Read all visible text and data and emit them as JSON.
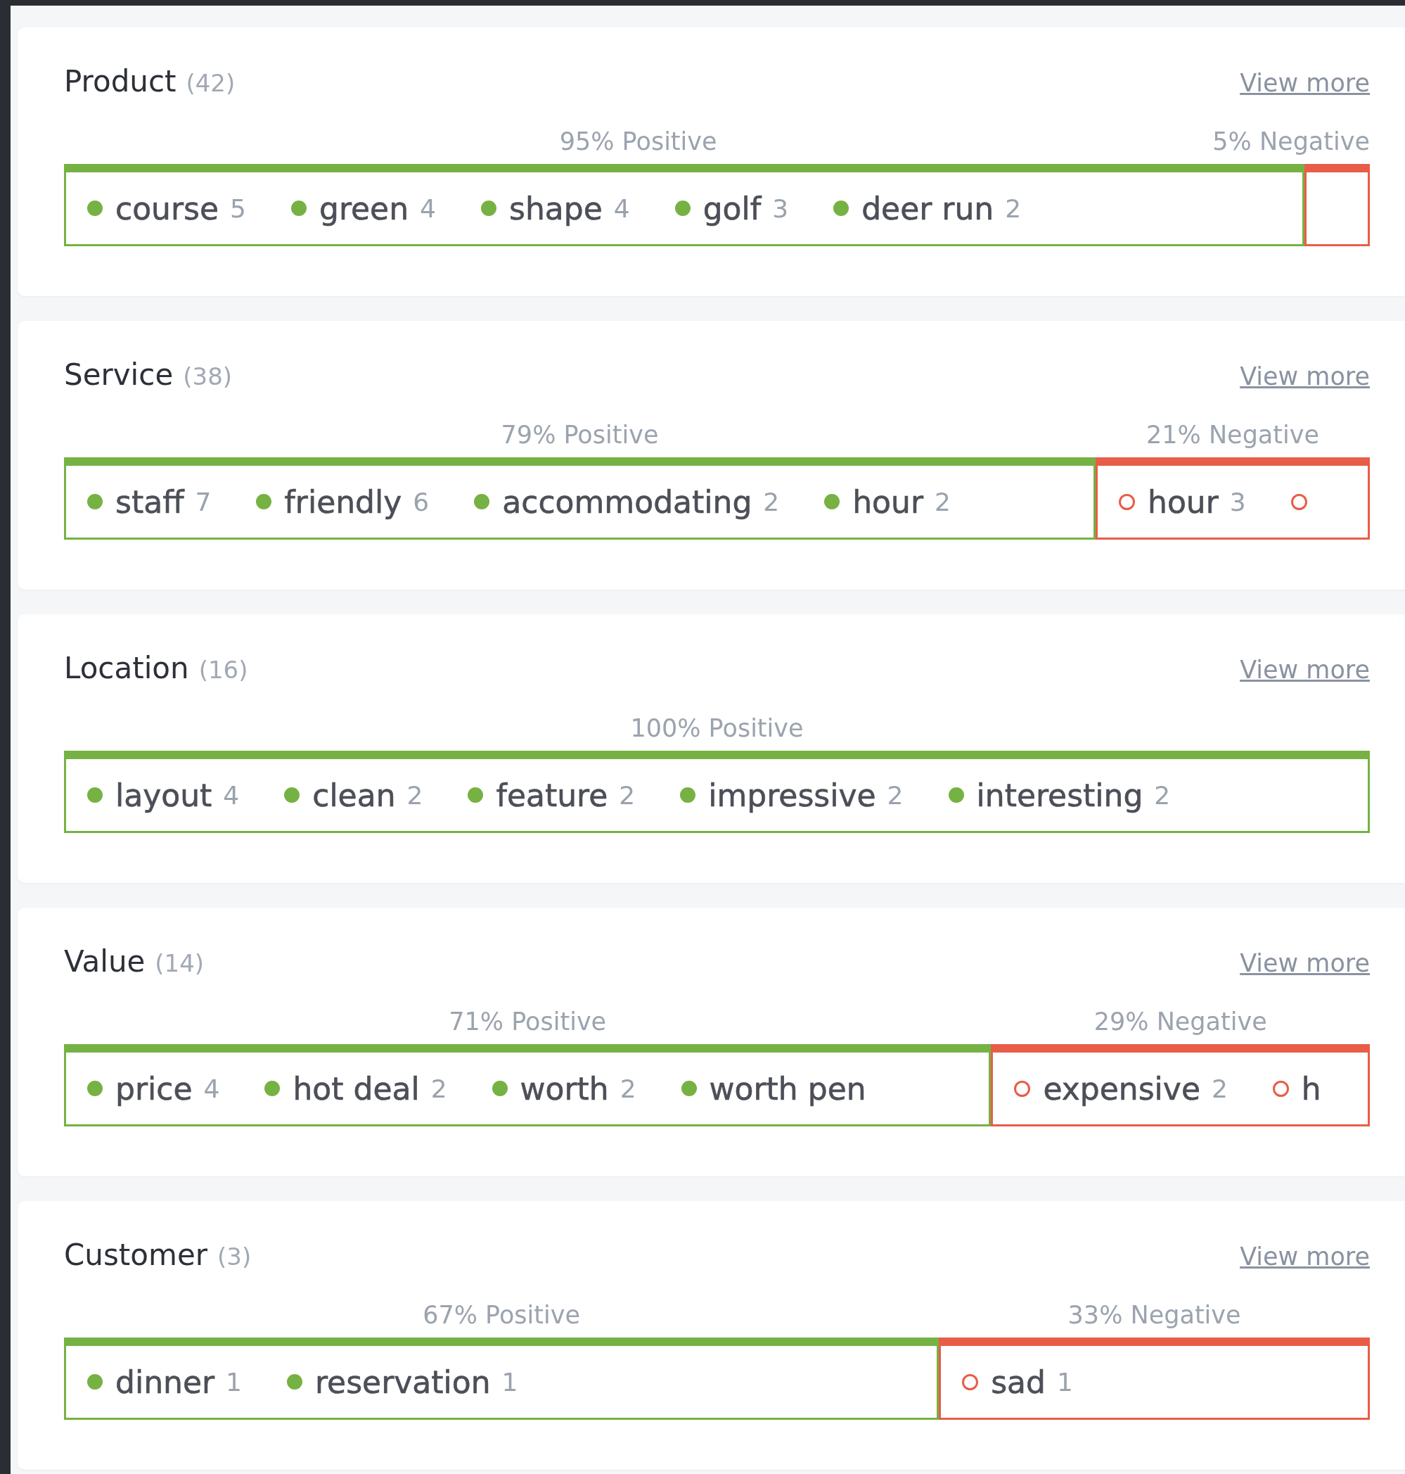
{
  "sections": [
    {
      "title": "Product",
      "count": "(42)",
      "link": "View more",
      "segments": [
        {
          "kind": "positive",
          "label": "95% Positive",
          "items": [
            {
              "name": "course",
              "count": "5"
            },
            {
              "name": "green",
              "count": "4"
            },
            {
              "name": "shape",
              "count": "4"
            },
            {
              "name": "golf",
              "count": "3"
            },
            {
              "name": "deer run",
              "count": "2"
            }
          ]
        },
        {
          "kind": "negative",
          "label": "5% Negative"
        }
      ]
    },
    {
      "title": "Service",
      "count": "(38)",
      "link": "View more",
      "segments": [
        {
          "kind": "positive",
          "label": "79% Positive",
          "items": [
            {
              "name": "staff",
              "count": "7"
            },
            {
              "name": "friendly",
              "count": "6"
            },
            {
              "name": "accommodating",
              "count": "2"
            },
            {
              "name": "hour",
              "count": "2"
            }
          ]
        },
        {
          "kind": "negative",
          "label": "21% Negative",
          "items": [
            {
              "kind": "keyword",
              "name": "hour",
              "count": "3"
            },
            {
              "kind": "icon_only"
            }
          ]
        }
      ]
    },
    {
      "title": "Location",
      "count": "(16)",
      "link": "View more",
      "segments": [
        {
          "kind": "positive",
          "label": "100% Positive",
          "items": [
            {
              "name": "layout",
              "count": "4"
            },
            {
              "name": "clean",
              "count": "2"
            },
            {
              "name": "feature",
              "count": "2"
            },
            {
              "name": "impressive",
              "count": "2"
            },
            {
              "name": "interesting",
              "count": "2"
            }
          ]
        }
      ]
    },
    {
      "title": "Value",
      "count": "(14)",
      "link": "View more",
      "segments": [
        {
          "kind": "positive",
          "label": "71% Positive",
          "items": [
            {
              "name": "price",
              "count": "4"
            },
            {
              "name": "hot deal",
              "count": "2"
            },
            {
              "name": "worth",
              "count": "2"
            },
            {
              "name": "worth pen"
            }
          ]
        },
        {
          "kind": "negative",
          "label": "29% Negative",
          "items": [
            {
              "name": "expensive",
              "count": "2"
            },
            {
              "name": "h"
            }
          ]
        }
      ]
    },
    {
      "title": "Customer",
      "count": "(3)",
      "link": "View more",
      "segments": [
        {
          "kind": "positive",
          "label": "67% Positive",
          "items": [
            {
              "name": "dinner",
              "count": "1"
            },
            {
              "name": "reservation",
              "count": "1"
            }
          ]
        },
        {
          "kind": "negative",
          "label": "33% Negative",
          "items": [
            {
              "name": "sad",
              "count": "1"
            }
          ]
        }
      ]
    }
  ]
}
